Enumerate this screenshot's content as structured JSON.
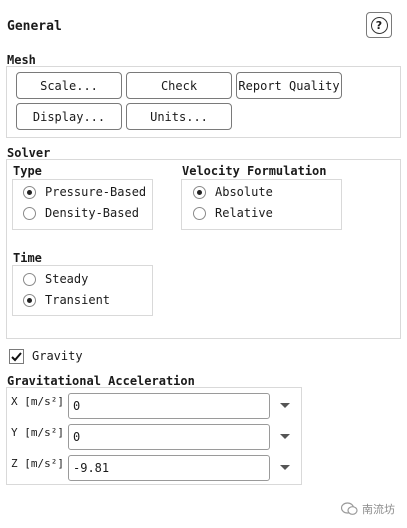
{
  "panel": {
    "title": "General",
    "help_icon": "help-icon",
    "help_glyph": "?"
  },
  "mesh": {
    "title": "Mesh",
    "buttons": {
      "scale": "Scale...",
      "check": "Check",
      "report_quality": "Report Quality",
      "display": "Display...",
      "units": "Units..."
    }
  },
  "solver": {
    "title": "Solver",
    "type": {
      "title": "Type",
      "options": [
        "Pressure-Based",
        "Density-Based"
      ],
      "selected": "Pressure-Based"
    },
    "velocity_formulation": {
      "title": "Velocity Formulation",
      "options": [
        "Absolute",
        "Relative"
      ],
      "selected": "Absolute"
    },
    "time": {
      "title": "Time",
      "options": [
        "Steady",
        "Transient"
      ],
      "selected": "Transient"
    }
  },
  "gravity": {
    "label": "Gravity",
    "checked": true
  },
  "gravitational_acceleration": {
    "title": "Gravitational Acceleration",
    "x_label": "X [m/s²]",
    "x_value": "0",
    "y_label": "Y [m/s²]",
    "y_value": "0",
    "z_label": "Z [m/s²]",
    "z_value": "-9.81"
  },
  "watermark": {
    "text": "南流坊"
  }
}
